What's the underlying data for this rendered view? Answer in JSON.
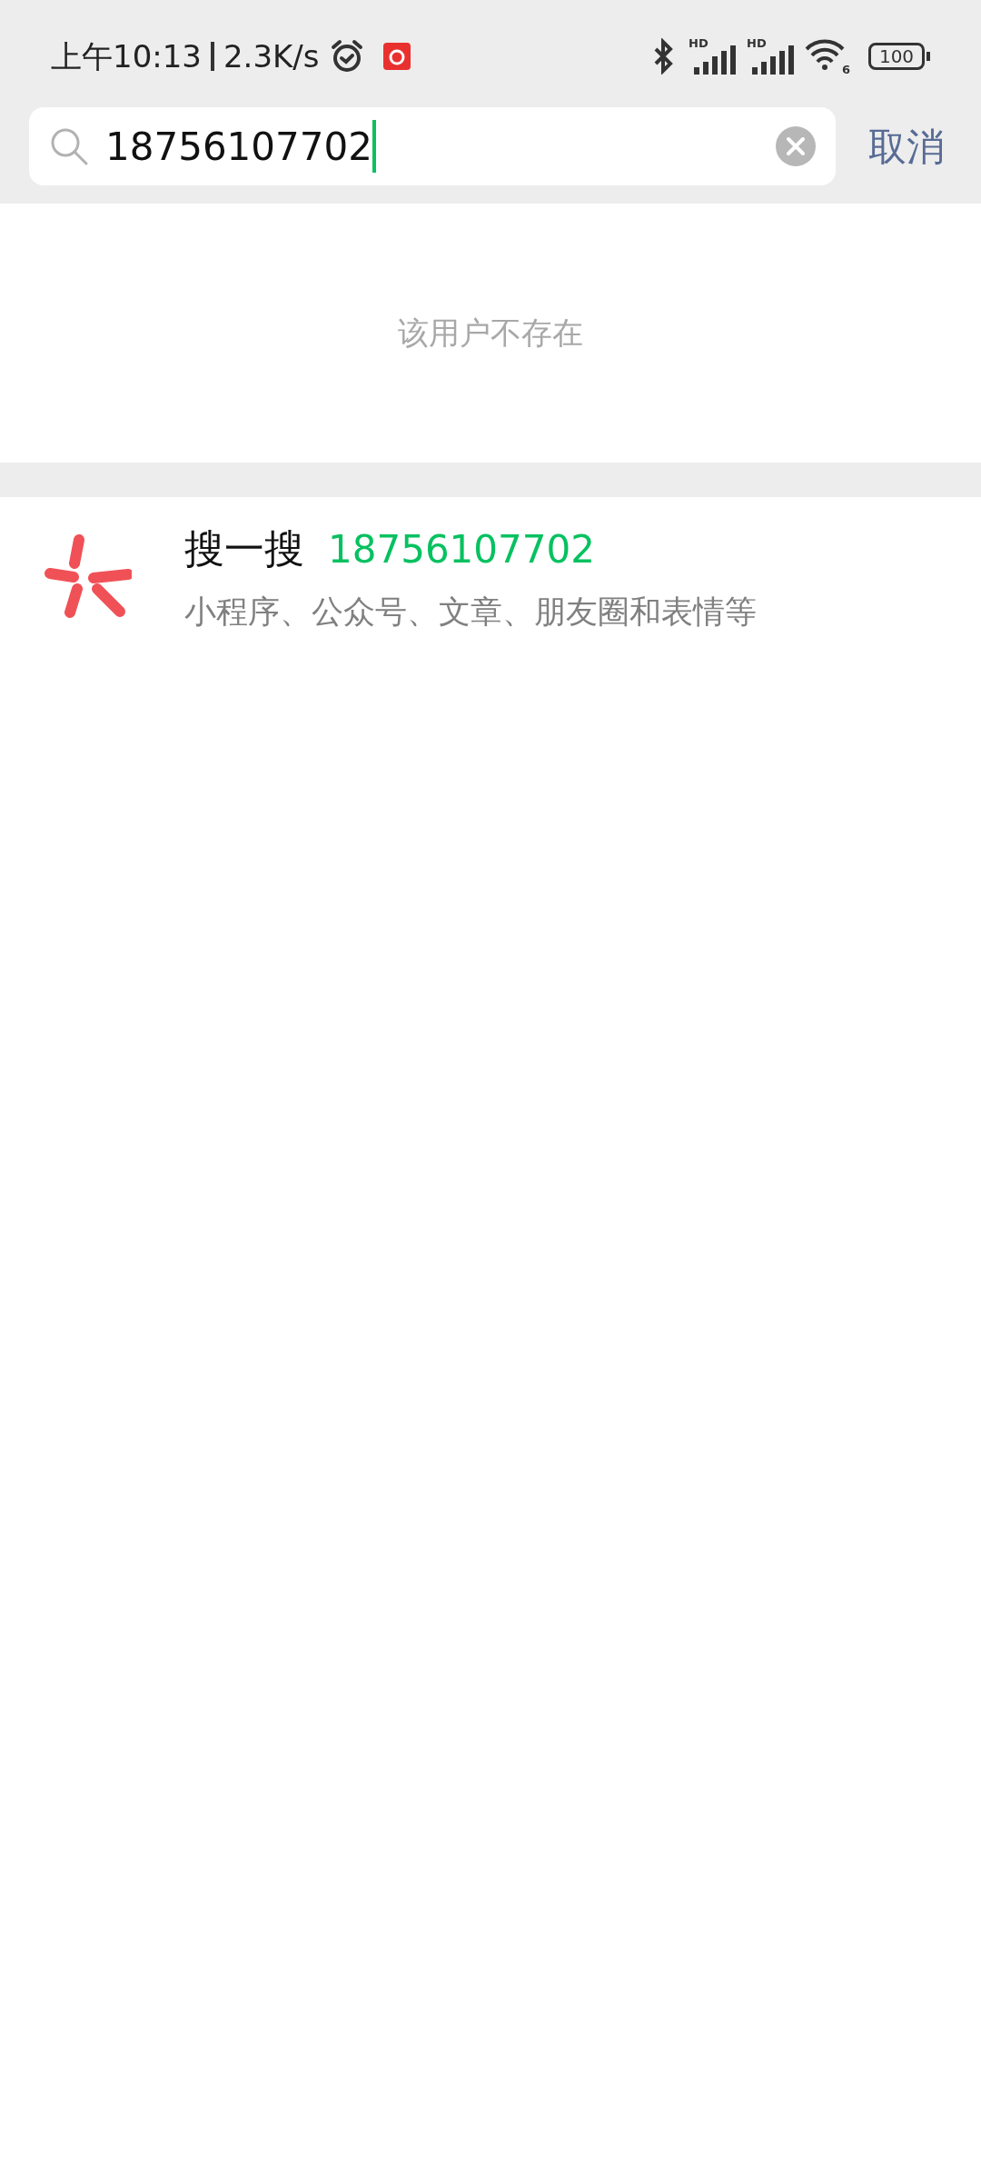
{
  "status_bar": {
    "time": "上午10:13",
    "speed": "2.3K/s",
    "signals": [
      {
        "label": "HD"
      },
      {
        "label": "HD"
      }
    ],
    "wifi_label": "6",
    "battery": "100"
  },
  "search": {
    "value": "18756107702",
    "cancel": "取消"
  },
  "message": "该用户不存在",
  "result": {
    "title": "搜一搜",
    "query": "18756107702",
    "subtitle": "小程序、公众号、文章、朋友圈和表情等"
  }
}
